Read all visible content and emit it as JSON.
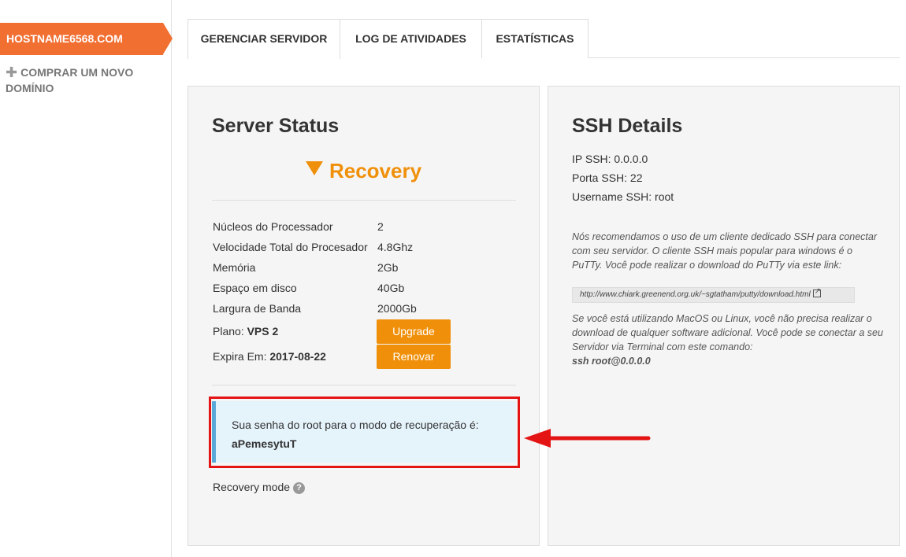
{
  "sidebar": {
    "active_item": "HOSTNAME6568.COM",
    "buy_domain": "COMPRAR UM NOVO DOMÍNIO"
  },
  "tabs": [
    {
      "label": "GERENCIAR SERVIDOR"
    },
    {
      "label": "LOG DE ATIVIDADES"
    },
    {
      "label": "ESTATÍSTICAS"
    }
  ],
  "server_status": {
    "title": "Server Status",
    "status": "Recovery",
    "specs": [
      {
        "label": "Núcleos do Processador",
        "value": "2"
      },
      {
        "label": "Velocidade Total do Procesador",
        "value": "4.8Ghz"
      },
      {
        "label": "Memória",
        "value": "2Gb"
      },
      {
        "label": "Espaço em disco",
        "value": "40Gb"
      },
      {
        "label": "Largura de Banda",
        "value": "2000Gb"
      }
    ],
    "plan_label": "Plano:",
    "plan_value": "VPS 2",
    "upgrade_button": "Upgrade",
    "expires_label": "Expira Em:",
    "expires_value": "2017-08-22",
    "renew_button": "Renovar",
    "alert_text": "Sua senha do root para o modo de recuperação é:",
    "alert_password": "aPemesytuT",
    "recovery_mode_label": "Recovery mode",
    "help_glyph": "?"
  },
  "ssh": {
    "title": "SSH Details",
    "ip_line": "IP SSH: 0.0.0.0",
    "port_line": "Porta SSH: 22",
    "user_line": "Username SSH: root",
    "note1": "Nós recomendamos o uso de um cliente dedicado SSH para conectar com seu servidor. O cliente SSH mais popular para windows é o PuTTy. Você pode realizar o download do PuTTy via este link:",
    "link": "http://www.chiark.greenend.org.uk/~sgtatham/putty/download.html",
    "note2": "Se você está utilizando MacOS ou Linux, você não precisa realizar o download de qualquer software adicional. Você pode se conectar a seu Servidor via Terminal com este comando:",
    "command": "ssh root@0.0.0.0"
  },
  "colors": {
    "accent": "#f26f32",
    "status": "#f0900a",
    "annotation": "#e41414"
  }
}
